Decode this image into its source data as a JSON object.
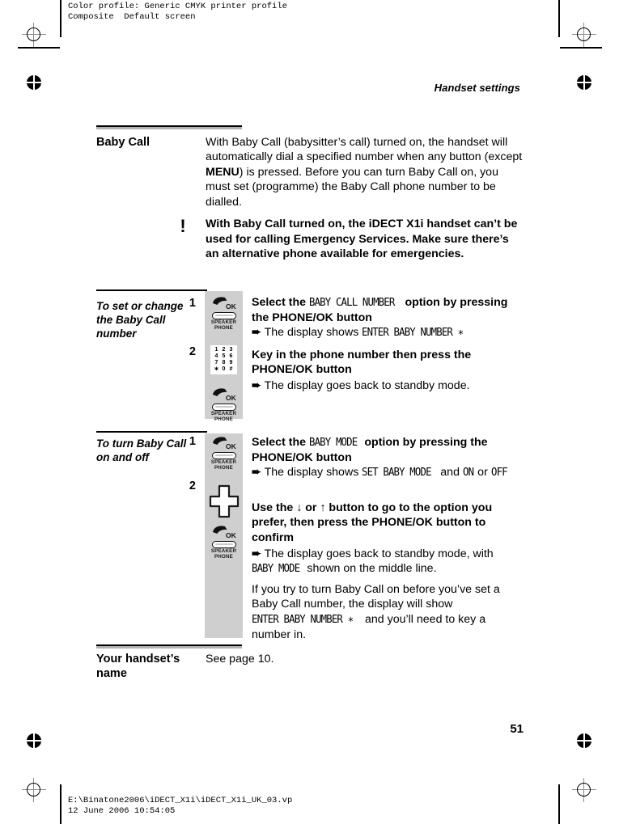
{
  "prepress": {
    "color_profile_line1": "Color profile: Generic CMYK printer profile",
    "color_profile_line2": "Composite  Default screen",
    "footer_path": "E:\\Binatone2006\\iDECT_X1i\\iDECT_X1i_UK_03.vp",
    "footer_timestamp": "12 June 2006 10:54:05"
  },
  "page": {
    "running_head": "Handset settings",
    "page_number": "51"
  },
  "baby_call": {
    "title": "Baby Call",
    "body_before_menu": "With Baby Call (babysitter’s call) turned on, the handset will automatically dial a specified number when any button (except ",
    "menu_label": "MENU",
    "body_after_menu": ") is pressed. Before you can turn Baby Call on, you must set (programme) the Baby Call phone number to be dialled.",
    "warning_icon": "!",
    "warning_text": "With Baby Call turned on, the iDECT X1i handset can’t be used for calling Emergency Services. Make sure there’s an alternative phone available for emergencies."
  },
  "set_number_section": {
    "title": "To set or change the Baby Call number",
    "steps": [
      {
        "number": "1",
        "icon": "phone-ok-button-icon",
        "text_part1": "Select the ",
        "lcd1": "BABY CALL NUMBER",
        "text_part2": " option by pressing the ",
        "button_label": "PHONE/OK",
        "text_part3": " button",
        "arrow_prefix": "The display shows ",
        "arrow_lcd": "ENTER BABY NUMBER ∗"
      },
      {
        "number": "2",
        "icon": "keypad-icon",
        "text_part1": "Key in the phone number then press the ",
        "button_label": "PHONE/OK",
        "text_part3": " button",
        "arrow_prefix": "The display goes back to standby mode.",
        "arrow_lcd": ""
      }
    ]
  },
  "baby_mode_section": {
    "title": "To turn Baby Call on and off",
    "steps": [
      {
        "number": "1",
        "icon": "phone-ok-button-icon",
        "text_part1": "Select the ",
        "lcd1": "BABY MODE",
        "text_part2": " option by pressing the ",
        "button_label": "PHONE/OK",
        "text_part3": " button",
        "arrow_prefix": "The display shows ",
        "arrow_lcd": "SET BABY MODE",
        "arrow_mid": " and ",
        "arrow_lcd2": "ON",
        "arrow_tail": " or ",
        "arrow_lcd3": "OFF"
      },
      {
        "number": "2",
        "icon": "navigation-pad-icon",
        "text_part1": "Use the ",
        "down_arrow": "↓",
        "text_or": " or ",
        "up_arrow": "↑",
        "text_part2": " button to go to the option you prefer, then press the ",
        "button_label": "PHONE/OK",
        "text_part3": " button to confirm",
        "arrow_prefix": "The display goes back to standby mode, with ",
        "arrow_lcd": "BABY MODE",
        "arrow_tail": " shown on the middle line."
      }
    ],
    "note_part1": "If you try to turn Baby Call on before you’ve set a Baby Call number, the display will show ",
    "note_lcd": "ENTER BABY NUMBER ∗",
    "note_part2": " and you’ll need to key a number in."
  },
  "handset_name_section": {
    "title": "Your handset’s name",
    "body": "See page 10."
  },
  "icons": {
    "phone_ok_caption_line1": "SPEAKER",
    "phone_ok_caption_line2": "PHONE",
    "ok_label": "OK",
    "keypad_keys": [
      "1",
      "2",
      "3",
      "4",
      "5",
      "6",
      "7",
      "8",
      "9",
      "∗",
      "0",
      "#"
    ]
  },
  "colors": {
    "icon_column_bg": "#cfcfcf",
    "rule_dark": "#000000",
    "rule_light": "#b3b3b3"
  }
}
